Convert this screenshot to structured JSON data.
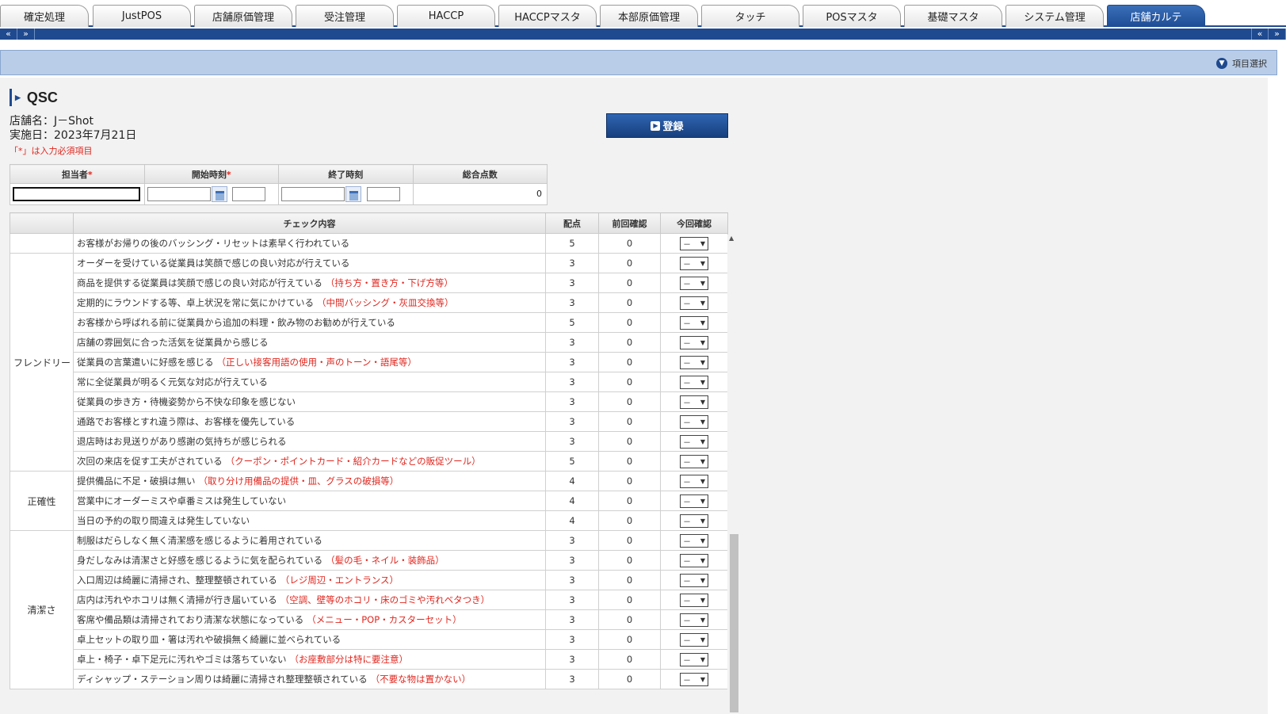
{
  "tabs": [
    {
      "label": "確定処理",
      "active": false
    },
    {
      "label": "JustPOS",
      "active": false
    },
    {
      "label": "店舗原価管理",
      "active": false
    },
    {
      "label": "受注管理",
      "active": false
    },
    {
      "label": "HACCP",
      "active": false
    },
    {
      "label": "HACCPマスタ",
      "active": false
    },
    {
      "label": "本部原価管理",
      "active": false
    },
    {
      "label": "タッチ",
      "active": false
    },
    {
      "label": "POSマスタ",
      "active": false
    },
    {
      "label": "基礎マスタ",
      "active": false
    },
    {
      "label": "システム管理",
      "active": false
    },
    {
      "label": "店舗カルテ",
      "active": true
    }
  ],
  "nav": {
    "prev": "«",
    "next": "»"
  },
  "item_select": {
    "label": "項目選択",
    "icon": "chevron-down-circle-icon"
  },
  "page": {
    "title": "QSC",
    "store_line": "店舗名：J－Shot",
    "date_line": "実施日：2023年7月21日",
    "required_note": "「*」は入力必須項目",
    "register_label": "登録"
  },
  "form": {
    "headers": {
      "person": "担当者",
      "start": "開始時刻",
      "end": "終了時刻",
      "total": "総合点数"
    },
    "required_mark": "*",
    "total_score": "0"
  },
  "check_table": {
    "headers": {
      "category": "",
      "content": "チェック内容",
      "points": "配点",
      "previous": "前回確認",
      "current": "今回確認"
    },
    "select_default": "－",
    "groups": [
      {
        "category": "",
        "items": [
          {
            "text": "お客様がお帰りの後のバッシング・リセットは素早く行われている",
            "hint": "",
            "points": "5",
            "previous": "0"
          }
        ]
      },
      {
        "category": "フレンドリー",
        "items": [
          {
            "text": "オーダーを受けている従業員は笑顔で感じの良い対応が行えている",
            "hint": "",
            "points": "3",
            "previous": "0"
          },
          {
            "text": "商品を提供する従業員は笑顔で感じの良い対応が行えている",
            "hint": "（持ち方・置き方・下げ方等）",
            "points": "3",
            "previous": "0"
          },
          {
            "text": "定期的にラウンドする等、卓上状況を常に気にかけている",
            "hint": "（中間バッシング・灰皿交換等）",
            "points": "3",
            "previous": "0"
          },
          {
            "text": "お客様から呼ばれる前に従業員から追加の料理・飲み物のお勧めが行えている",
            "hint": "",
            "points": "5",
            "previous": "0"
          },
          {
            "text": "店舗の雰囲気に合った活気を従業員から感じる",
            "hint": "",
            "points": "3",
            "previous": "0"
          },
          {
            "text": "従業員の言葉遣いに好感を感じる",
            "hint": "（正しい接客用語の使用・声のトーン・語尾等）",
            "points": "3",
            "previous": "0"
          },
          {
            "text": "常に全従業員が明るく元気な対応が行えている",
            "hint": "",
            "points": "3",
            "previous": "0"
          },
          {
            "text": "従業員の歩き方・待機姿勢から不快な印象を感じない",
            "hint": "",
            "points": "3",
            "previous": "0"
          },
          {
            "text": "通路でお客様とすれ違う際は、お客様を優先している",
            "hint": "",
            "points": "3",
            "previous": "0"
          },
          {
            "text": "退店時はお見送りがあり感謝の気持ちが感じられる",
            "hint": "",
            "points": "3",
            "previous": "0"
          },
          {
            "text": "次回の来店を促す工夫がされている",
            "hint": "（クーポン・ポイントカード・紹介カードなどの販促ツール）",
            "points": "5",
            "previous": "0"
          }
        ]
      },
      {
        "category": "正確性",
        "items": [
          {
            "text": "提供備品に不足・破損は無い",
            "hint": "（取り分け用備品の提供・皿、グラスの破損等）",
            "points": "4",
            "previous": "0"
          },
          {
            "text": "営業中にオーダーミスや卓番ミスは発生していない",
            "hint": "",
            "points": "4",
            "previous": "0"
          },
          {
            "text": "当日の予約の取り間違えは発生していない",
            "hint": "",
            "points": "4",
            "previous": "0"
          }
        ]
      },
      {
        "category": "清潔さ",
        "items": [
          {
            "text": "制服はだらしなく無く清潔感を感じるように着用されている",
            "hint": "",
            "points": "3",
            "previous": "0"
          },
          {
            "text": "身だしなみは清潔さと好感を感じるように気を配られている",
            "hint": "（髪の毛・ネイル・装飾品）",
            "points": "3",
            "previous": "0"
          },
          {
            "text": "入口周辺は綺麗に清掃され、整理整頓されている",
            "hint": "（レジ周辺・エントランス）",
            "points": "3",
            "previous": "0"
          },
          {
            "text": "店内は汚れやホコリは無く清掃が行き届いている",
            "hint": "（空調、壁等のホコリ・床のゴミや汚れベタつき）",
            "points": "3",
            "previous": "0"
          },
          {
            "text": "客席や備品類は清掃されており清潔な状態になっている",
            "hint": "（メニュー・POP・カスターセット）",
            "points": "3",
            "previous": "0"
          },
          {
            "text": "卓上セットの取り皿・箸は汚れや破損無く綺麗に並べられている",
            "hint": "",
            "points": "3",
            "previous": "0"
          },
          {
            "text": "卓上・椅子・卓下足元に汚れやゴミは落ちていない",
            "hint": "（お座敷部分は特に要注意）",
            "points": "3",
            "previous": "0"
          },
          {
            "text": "ディシャップ・ステーション周りは綺麗に清掃され整理整頓されている",
            "hint": "（不要な物は置かない）",
            "points": "3",
            "previous": "0"
          }
        ]
      }
    ]
  }
}
